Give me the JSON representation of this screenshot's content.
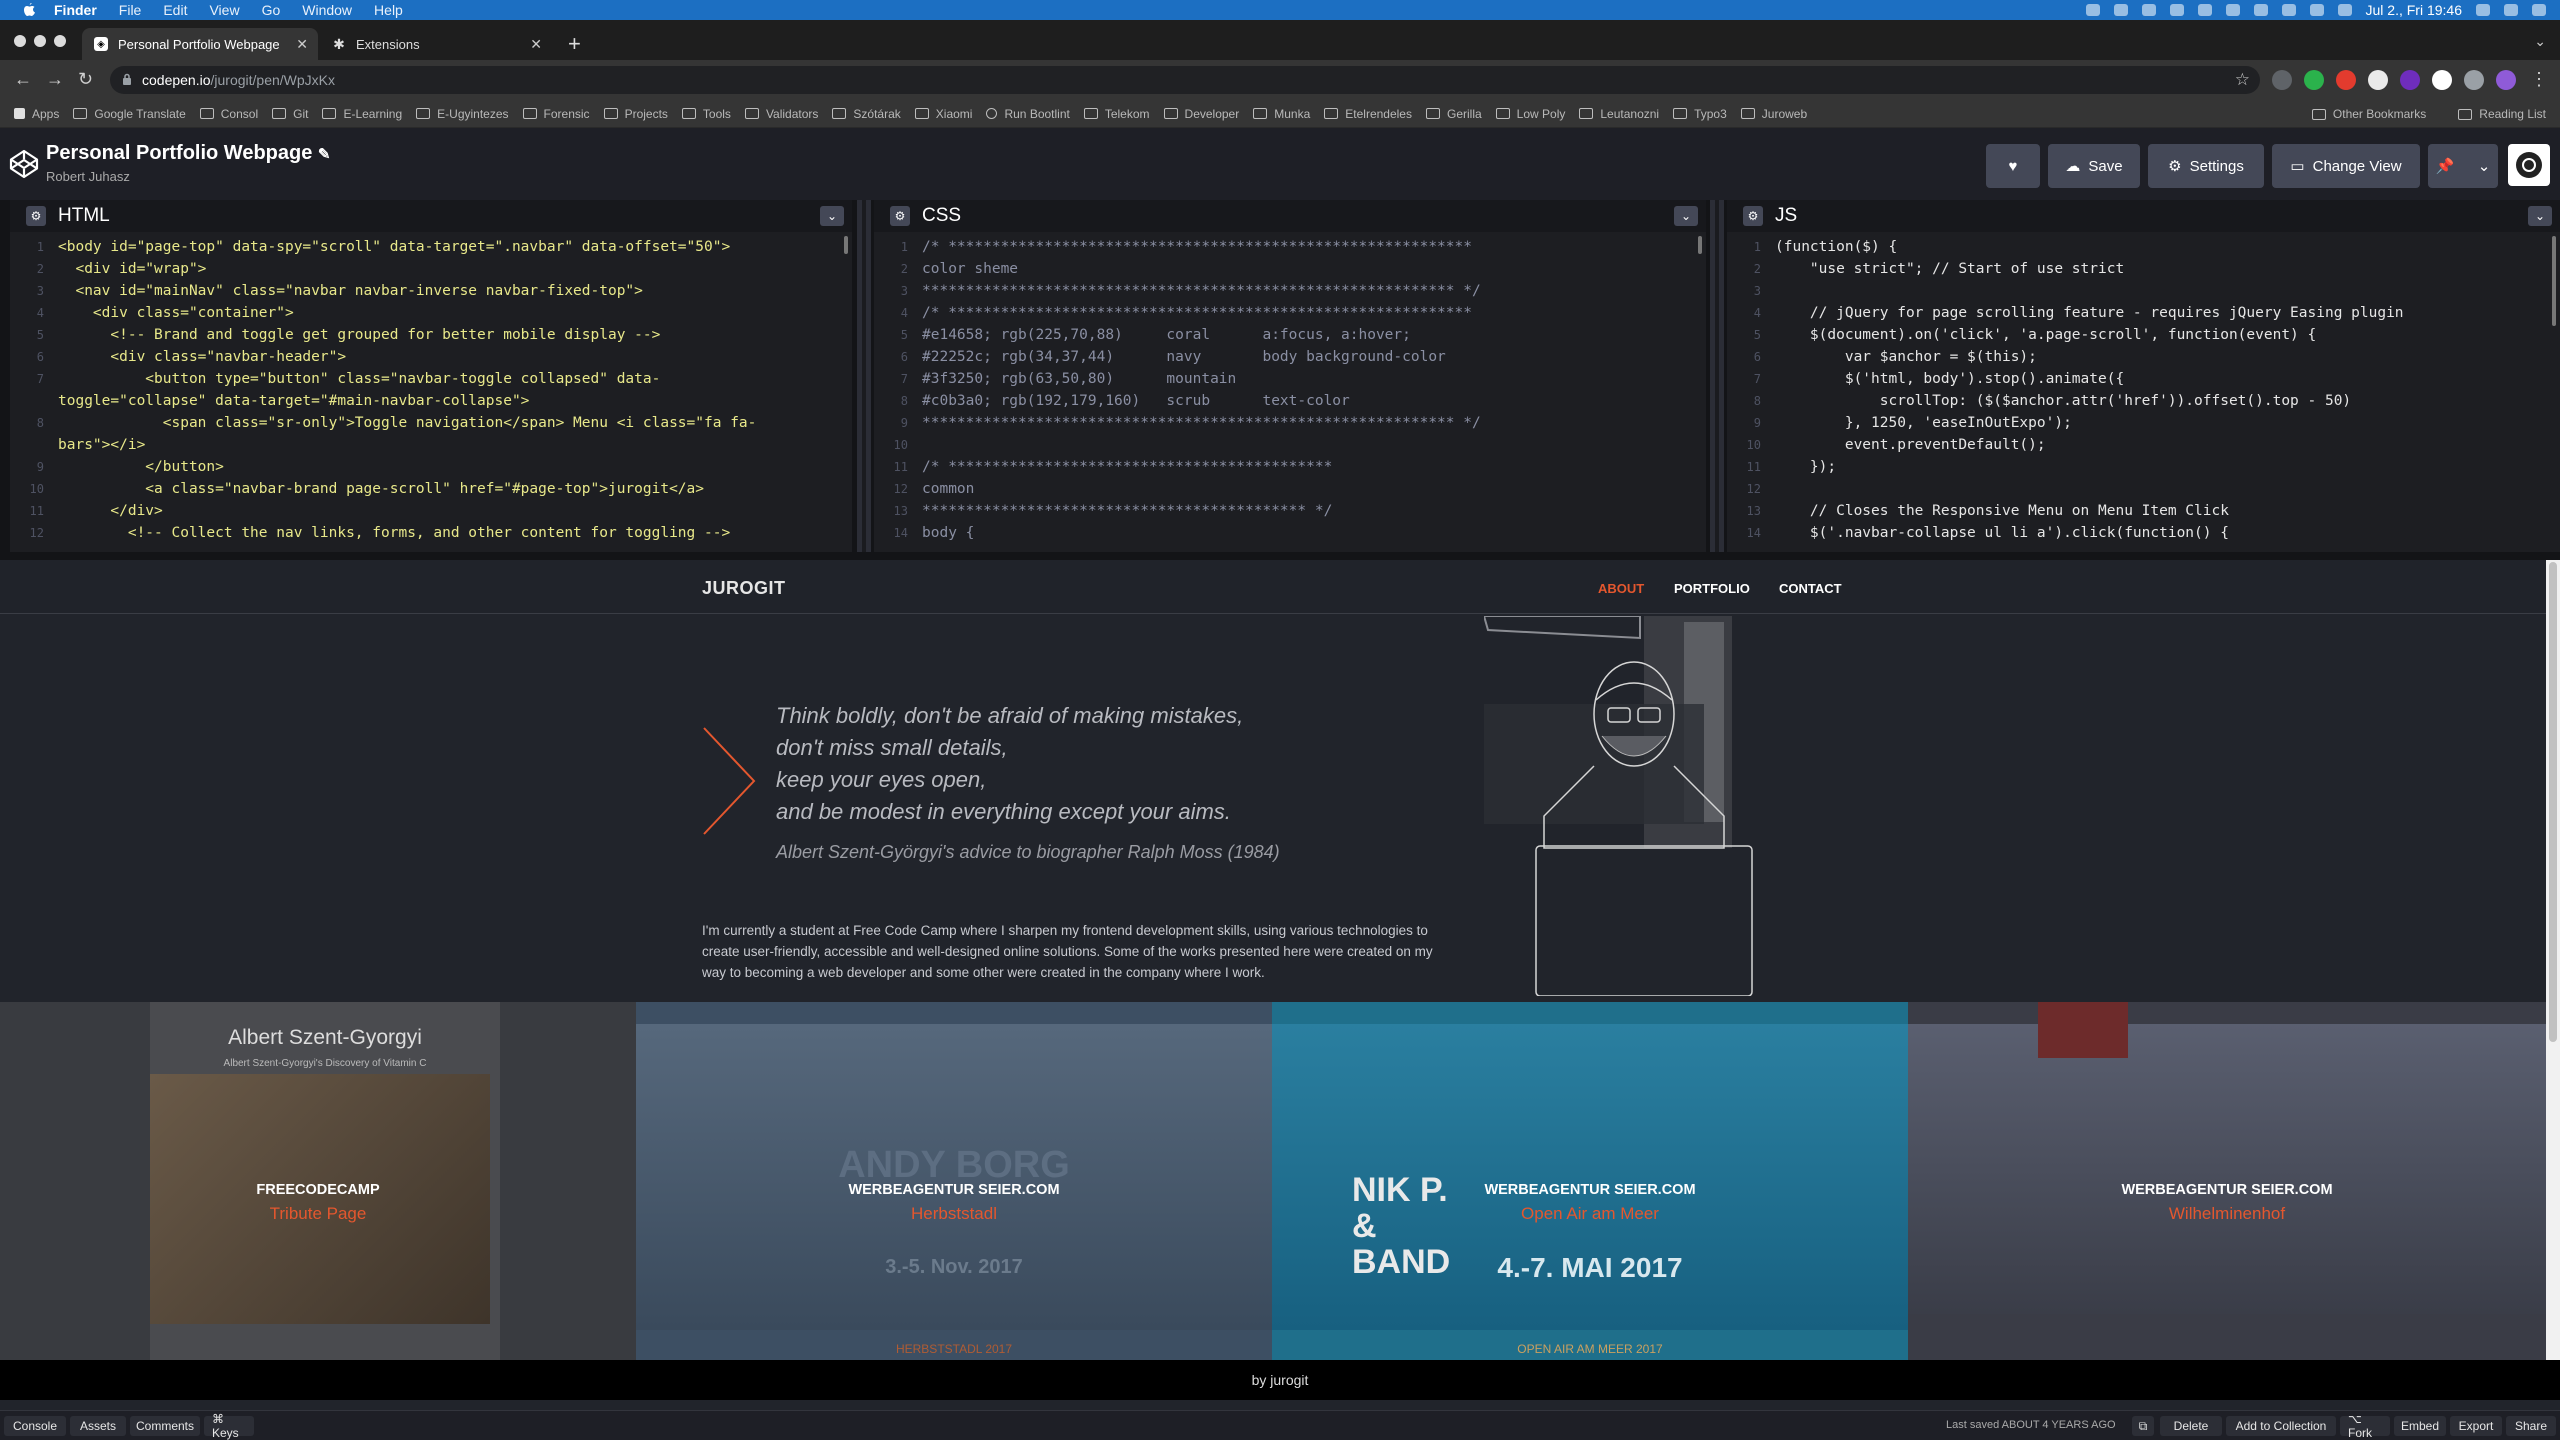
{
  "menubar": {
    "items": [
      "Finder",
      "File",
      "Edit",
      "View",
      "Go",
      "Window",
      "Help"
    ],
    "clock": "Jul 2., Fri  19:46"
  },
  "browser": {
    "tabs": [
      {
        "label": "Personal Portfolio Webpage",
        "active": true
      },
      {
        "label": "Extensions",
        "active": false
      }
    ],
    "url_host": "codepen.io",
    "url_path": "/jurogit/pen/WpJxKx",
    "bookmarks": [
      "Apps",
      "Google Translate",
      "Consol",
      "Git",
      "E-Learning",
      "E-Ugyintezes",
      "Forensic",
      "Projects",
      "Tools",
      "Validators",
      "Szótárak",
      "Xiaomi",
      "Run Bootlint",
      "Telekom",
      "Developer",
      "Munka",
      "Etelrendeles",
      "Gerilla",
      "Low Poly",
      "Leutanozni",
      "Typo3",
      "Juroweb"
    ],
    "bookmarks_right": [
      "Other Bookmarks",
      "Reading List"
    ]
  },
  "codepen": {
    "title": "Personal Portfolio Webpage",
    "author": "Robert Juhasz",
    "save_label": "Save",
    "settings_label": "Settings",
    "change_view_label": "Change View"
  },
  "editors": {
    "html": {
      "title": "HTML",
      "lines": [
        {
          "n": "1",
          "t": "<body id=\"page-top\" data-spy=\"scroll\" data-target=\".navbar\" data-offset=\"50\">"
        },
        {
          "n": "2",
          "t": "  <div id=\"wrap\">"
        },
        {
          "n": "3",
          "t": "  <nav id=\"mainNav\" class=\"navbar navbar-inverse navbar-fixed-top\">"
        },
        {
          "n": "4",
          "t": "    <div class=\"container\">"
        },
        {
          "n": "5",
          "t": "      <!-- Brand and toggle get grouped for better mobile display -->"
        },
        {
          "n": "6",
          "t": "      <div class=\"navbar-header\">"
        },
        {
          "n": "7",
          "t": "          <button type=\"button\" class=\"navbar-toggle collapsed\" data-"
        },
        {
          "n": "",
          "t": "toggle=\"collapse\" data-target=\"#main-navbar-collapse\">"
        },
        {
          "n": "8",
          "t": "            <span class=\"sr-only\">Toggle navigation</span> Menu <i class=\"fa fa-"
        },
        {
          "n": "",
          "t": "bars\"></i>"
        },
        {
          "n": "9",
          "t": "          </button>"
        },
        {
          "n": "10",
          "t": "          <a class=\"navbar-brand page-scroll\" href=\"#page-top\">jurogit</a>"
        },
        {
          "n": "11",
          "t": "      </div>"
        },
        {
          "n": "12",
          "t": "        <!-- Collect the nav links, forms, and other content for toggling -->"
        }
      ]
    },
    "css": {
      "title": "CSS",
      "lines": [
        {
          "n": "1",
          "t": "/* ************************************************************"
        },
        {
          "n": "2",
          "t": "color sheme"
        },
        {
          "n": "3",
          "t": "************************************************************* */"
        },
        {
          "n": "4",
          "t": "/* ************************************************************"
        },
        {
          "n": "5",
          "t": "#e14658; rgb(225,70,88)     coral      a:focus, a:hover;"
        },
        {
          "n": "6",
          "t": "#22252c; rgb(34,37,44)      navy       body background-color"
        },
        {
          "n": "7",
          "t": "#3f3250; rgb(63,50,80)      mountain"
        },
        {
          "n": "8",
          "t": "#c0b3a0; rgb(192,179,160)   scrub      text-color"
        },
        {
          "n": "9",
          "t": "************************************************************* */"
        },
        {
          "n": "10",
          "t": ""
        },
        {
          "n": "11",
          "t": "/* ********************************************"
        },
        {
          "n": "12",
          "t": "common"
        },
        {
          "n": "13",
          "t": "******************************************** */"
        },
        {
          "n": "14",
          "t": "body {"
        }
      ]
    },
    "js": {
      "title": "JS",
      "lines": [
        {
          "n": "1",
          "t": "(function($) {"
        },
        {
          "n": "2",
          "t": "    \"use strict\"; // Start of use strict"
        },
        {
          "n": "3",
          "t": ""
        },
        {
          "n": "4",
          "t": "    // jQuery for page scrolling feature - requires jQuery Easing plugin"
        },
        {
          "n": "5",
          "t": "    $(document).on('click', 'a.page-scroll', function(event) {"
        },
        {
          "n": "6",
          "t": "        var $anchor = $(this);"
        },
        {
          "n": "7",
          "t": "        $('html, body').stop().animate({"
        },
        {
          "n": "8",
          "t": "            scrollTop: ($($anchor.attr('href')).offset().top - 50)"
        },
        {
          "n": "9",
          "t": "        }, 1250, 'easeInOutExpo');"
        },
        {
          "n": "10",
          "t": "        event.preventDefault();"
        },
        {
          "n": "11",
          "t": "    });"
        },
        {
          "n": "12",
          "t": ""
        },
        {
          "n": "13",
          "t": "    // Closes the Responsive Menu on Menu Item Click"
        },
        {
          "n": "14",
          "t": "    $('.navbar-collapse ul li a').click(function() {"
        }
      ]
    }
  },
  "preview": {
    "brand": "JUROGIT",
    "nav": [
      "ABOUT",
      "PORTFOLIO",
      "CONTACT"
    ],
    "nav_active_color": "#e4572e",
    "quote_lines": [
      "Think boldly, don't be afraid of making mistakes,",
      "don't miss small details,",
      "keep your eyes open,",
      "and be modest in everything except your aims."
    ],
    "quote_source": "Albert Szent-Györgyi's advice to biographer Ralph Moss (1984)",
    "about": "I'm currently a student at Free Code Camp where I sharpen my frontend development skills, using various technologies to create user-friendly, accessible and well-designed online solutions. Some of the works presented here were created on my way to becoming a web developer and some other were created in the company where I work.",
    "tiles": [
      {
        "heading": "Albert Szent-Gyorgyi",
        "subheading": "Albert Szent-Gyorgyi's Discovery of Vitamin C",
        "company": "FREECODECAMP",
        "project": "Tribute Page",
        "bg": "#3b3e44"
      },
      {
        "heading": "ANDY BORG",
        "subheading": "3.-5. Nov. 2017",
        "caption": "HERBSTSTADL 2017",
        "company": "WERBEAGENTUR SEIER.COM",
        "project": "Herbststadl",
        "bg": "#3d4f63"
      },
      {
        "heading": "NIK P. & BAND",
        "subheading": "4.-7. MAI 2017",
        "caption": "OPEN AIR AM MEER 2017",
        "company": "WERBEAGENTUR SEIER.COM",
        "project": "Open Air am Meer",
        "bg": "#1f6f8b"
      },
      {
        "heading": "",
        "subheading": "",
        "company": "WERBEAGENTUR SEIER.COM",
        "project": "Wilhelminenhof",
        "bg": "#3a3c46"
      }
    ],
    "footer": "by jurogit"
  },
  "bottom": {
    "left": [
      "Console",
      "Assets",
      "Comments",
      "⌘ Keys"
    ],
    "saved": "Last saved ABOUT 4 YEARS AGO",
    "right": [
      "Delete",
      "Add to Collection",
      "⌥ Fork",
      "Embed",
      "Export",
      "Share"
    ]
  }
}
